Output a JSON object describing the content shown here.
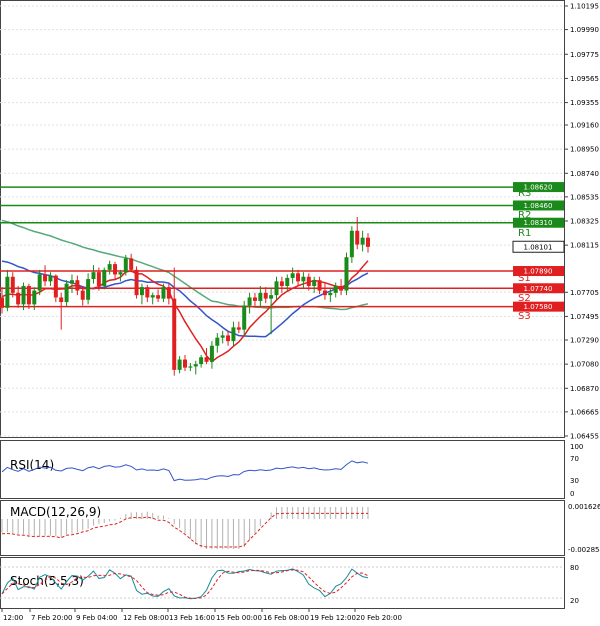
{
  "main_axis": {
    "ticks": [
      "1.10195",
      "1.09990",
      "1.09775",
      "1.09565",
      "1.09355",
      "1.09160",
      "1.08950",
      "1.08740",
      "1.08535",
      "1.08325",
      "1.08115",
      "1.07705",
      "1.07495",
      "1.07290",
      "1.07080",
      "1.06870",
      "1.06665",
      "1.06455"
    ],
    "ymin": 1.06455,
    "ymax": 1.10195
  },
  "levels": [
    {
      "name": "R3",
      "price_label": "1.08620",
      "value": 1.0862,
      "color": "#1a8a1a"
    },
    {
      "name": "R2",
      "price_label": "1.08460",
      "value": 1.0846,
      "color": "#1a8a1a"
    },
    {
      "name": "R1",
      "price_label": "1.08310",
      "value": 1.0831,
      "color": "#1a8a1a"
    },
    {
      "name": "S1",
      "price_label": "1.07890",
      "value": 1.0789,
      "color": "#e02020"
    },
    {
      "name": "S2",
      "price_label": "1.07740",
      "value": 1.0774,
      "color": "#e02020"
    },
    {
      "name": "S3",
      "price_label": "1.07580",
      "value": 1.0758,
      "color": "#e02020"
    }
  ],
  "current_price": {
    "label": "1.08101",
    "value": 1.08101
  },
  "time_axis": [
    "12:00",
    "7 Feb 20:00",
    "9 Feb 04:00",
    "12 Feb 08:00",
    "13 Feb 16:00",
    "15 Feb 00:00",
    "16 Feb 08:00",
    "19 Feb 12:00",
    "20 Feb 20:00"
  ],
  "rsi": {
    "label": "RSI(14)",
    "ticks": [
      "100",
      "70",
      "30",
      "0"
    ]
  },
  "macd": {
    "label": "MACD(12,26,9)",
    "ticks": [
      "0.001626",
      "-0.002854"
    ]
  },
  "stoch": {
    "label": "Stoch(5,5,3)",
    "ticks": [
      "80",
      "20"
    ]
  },
  "colors": {
    "bull": "#1a8a1a",
    "bear": "#e02020",
    "ma_fast": "#e02020",
    "ma_mid": "#3355cc",
    "ma_slow": "#55aa77",
    "grid": "#e0e0e0"
  },
  "chart_data": {
    "type": "candlestick",
    "candles": [
      [
        1.0766,
        1.0775,
        1.0752,
        1.0757
      ],
      [
        1.0757,
        1.079,
        1.0754,
        1.0784
      ],
      [
        1.0784,
        1.0788,
        1.0766,
        1.077
      ],
      [
        1.077,
        1.0776,
        1.0757,
        1.076
      ],
      [
        1.076,
        1.0779,
        1.0755,
        1.0776
      ],
      [
        1.0776,
        1.0778,
        1.0756,
        1.076
      ],
      [
        1.076,
        1.0775,
        1.0755,
        1.0772
      ],
      [
        1.0772,
        1.079,
        1.0768,
        1.0786
      ],
      [
        1.0786,
        1.0794,
        1.0776,
        1.078
      ],
      [
        1.078,
        1.0788,
        1.0776,
        1.0785
      ],
      [
        1.0785,
        1.0786,
        1.0762,
        1.0766
      ],
      [
        1.0766,
        1.077,
        1.0738,
        1.0762
      ],
      [
        1.0762,
        1.0781,
        1.0758,
        1.0778
      ],
      [
        1.0778,
        1.0786,
        1.077,
        1.0781
      ],
      [
        1.0781,
        1.0785,
        1.0768,
        1.0772
      ],
      [
        1.0772,
        1.0776,
        1.0759,
        1.0764
      ],
      [
        1.0764,
        1.0787,
        1.076,
        1.0782
      ],
      [
        1.0782,
        1.0794,
        1.0778,
        1.0788
      ],
      [
        1.0788,
        1.0792,
        1.0772,
        1.0776
      ],
      [
        1.0776,
        1.0792,
        1.0773,
        1.079
      ],
      [
        1.079,
        1.0798,
        1.0786,
        1.0795
      ],
      [
        1.0795,
        1.0797,
        1.0781,
        1.0786
      ],
      [
        1.0786,
        1.079,
        1.078,
        1.0788
      ],
      [
        1.0788,
        1.0803,
        1.0785,
        1.08
      ],
      [
        1.08,
        1.0804,
        1.0788,
        1.079
      ],
      [
        1.079,
        1.0793,
        1.0765,
        1.0768
      ],
      [
        1.0768,
        1.0778,
        1.076,
        1.0775
      ],
      [
        1.0775,
        1.0777,
        1.0762,
        1.0766
      ],
      [
        1.0766,
        1.077,
        1.076,
        1.0768
      ],
      [
        1.0768,
        1.0773,
        1.0762,
        1.0765
      ],
      [
        1.0765,
        1.0778,
        1.0762,
        1.0775
      ],
      [
        1.0775,
        1.0778,
        1.076,
        1.0765
      ],
      [
        1.0765,
        1.0792,
        1.0698,
        1.0703
      ],
      [
        1.0703,
        1.0715,
        1.07,
        1.0712
      ],
      [
        1.0712,
        1.0716,
        1.0702,
        1.0705
      ],
      [
        1.0705,
        1.0709,
        1.0702,
        1.0706
      ],
      [
        1.0706,
        1.0711,
        1.0699,
        1.0708
      ],
      [
        1.0708,
        1.0716,
        1.0705,
        1.0714
      ],
      [
        1.0714,
        1.0722,
        1.0708,
        1.071
      ],
      [
        1.071,
        1.0728,
        1.0704,
        1.0724
      ],
      [
        1.0724,
        1.0735,
        1.0718,
        1.0731
      ],
      [
        1.0731,
        1.0737,
        1.0726,
        1.0733
      ],
      [
        1.0733,
        1.0737,
        1.0724,
        1.0728
      ],
      [
        1.0728,
        1.0745,
        1.0724,
        1.074
      ],
      [
        1.074,
        1.0745,
        1.0735,
        1.0738
      ],
      [
        1.0738,
        1.0763,
        1.0733,
        1.0759
      ],
      [
        1.0759,
        1.077,
        1.0752,
        1.0766
      ],
      [
        1.0766,
        1.077,
        1.0758,
        1.0763
      ],
      [
        1.0763,
        1.0776,
        1.0758,
        1.077
      ],
      [
        1.077,
        1.0775,
        1.0761,
        1.0765
      ],
      [
        1.0765,
        1.0774,
        1.0734,
        1.0768
      ],
      [
        1.0768,
        1.0784,
        1.0764,
        1.078
      ],
      [
        1.078,
        1.0784,
        1.077,
        1.0776
      ],
      [
        1.0776,
        1.0786,
        1.0772,
        1.0783
      ],
      [
        1.0783,
        1.0792,
        1.0778,
        1.0787
      ],
      [
        1.0787,
        1.079,
        1.0776,
        1.078
      ],
      [
        1.078,
        1.0788,
        1.0774,
        1.0784
      ],
      [
        1.0784,
        1.0787,
        1.0772,
        1.0776
      ],
      [
        1.0776,
        1.0784,
        1.077,
        1.0781
      ],
      [
        1.0781,
        1.0784,
        1.0769,
        1.0772
      ],
      [
        1.0772,
        1.0779,
        1.0764,
        1.0768
      ],
      [
        1.0768,
        1.0774,
        1.0762,
        1.077
      ],
      [
        1.077,
        1.0779,
        1.0766,
        1.0776
      ],
      [
        1.0776,
        1.0782,
        1.0768,
        1.0772
      ],
      [
        1.0772,
        1.0805,
        1.0768,
        1.0801
      ],
      [
        1.0801,
        1.0828,
        1.0796,
        1.0824
      ],
      [
        1.0824,
        1.0836,
        1.0808,
        1.0812
      ],
      [
        1.0812,
        1.0824,
        1.0806,
        1.0818
      ],
      [
        1.0818,
        1.0822,
        1.0805,
        1.081
      ]
    ],
    "title": "",
    "xlabel": "",
    "ylabel": "",
    "ylim": [
      1.06455,
      1.10195
    ],
    "grid": true
  }
}
